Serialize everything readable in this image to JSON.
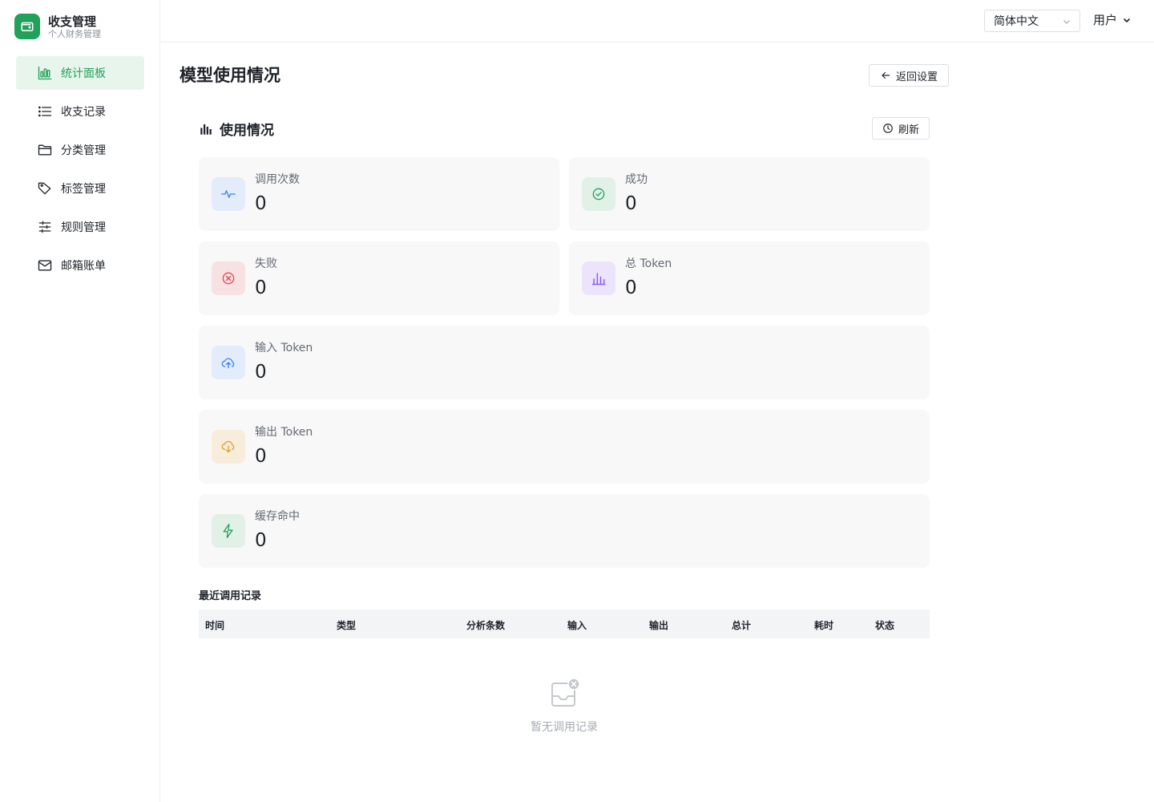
{
  "brand": {
    "title": "收支管理",
    "subtitle": "个人财务管理",
    "logo_icon": "wallet-icon",
    "color": "#22a15a"
  },
  "sidebar": {
    "items": [
      {
        "label": "统计面板",
        "icon": "bar-chart-icon",
        "active": true
      },
      {
        "label": "收支记录",
        "icon": "list-icon"
      },
      {
        "label": "分类管理",
        "icon": "folder-icon"
      },
      {
        "label": "标签管理",
        "icon": "tag-icon"
      },
      {
        "label": "规则管理",
        "icon": "sliders-icon"
      },
      {
        "label": "邮箱账单",
        "icon": "mail-icon"
      }
    ]
  },
  "topbar": {
    "language": "简体中文",
    "user": "用户"
  },
  "page": {
    "title": "模型使用情况",
    "back_label": "返回设置"
  },
  "usage": {
    "title": "使用情况",
    "refresh_label": "刷新",
    "stats": [
      {
        "label": "调用次数",
        "value": "0",
        "icon": "activity-icon",
        "color": "#3b82f6"
      },
      {
        "label": "成功",
        "value": "0",
        "icon": "check-circle-icon",
        "color": "#22a15a"
      },
      {
        "label": "失败",
        "value": "0",
        "icon": "x-circle-icon",
        "color": "#e5484d"
      },
      {
        "label": "总 Token",
        "value": "0",
        "icon": "bar-chart-icon",
        "color": "#8b5cf6"
      },
      {
        "label": "输入 Token",
        "value": "0",
        "icon": "cloud-upload-icon",
        "color": "#3b82f6"
      },
      {
        "label": "输出 Token",
        "value": "0",
        "icon": "cloud-download-icon",
        "color": "#e0a12b"
      },
      {
        "label": "缓存命中",
        "value": "0",
        "icon": "lightning-icon",
        "color": "#22a15a"
      }
    ]
  },
  "recent": {
    "title": "最近调用记录",
    "columns": [
      "时间",
      "类型",
      "分析条数",
      "输入",
      "输出",
      "总计",
      "耗时",
      "状态"
    ],
    "empty_text": "暂无调用记录"
  }
}
